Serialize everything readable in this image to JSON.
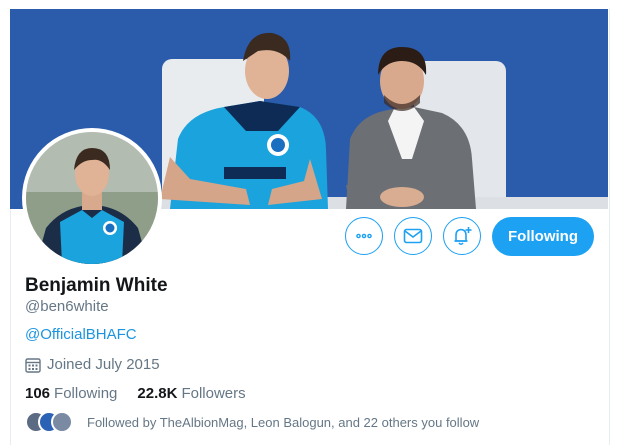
{
  "profile": {
    "name": "Benjamin White",
    "handle": "@ben6white",
    "link": "@OfficialBHAFC",
    "joined": "Joined July 2015"
  },
  "stats": {
    "following_count": "106",
    "following_label": "Following",
    "followers_count": "22.8K",
    "followers_label": "Followers"
  },
  "followed_by": {
    "text": "Followed by TheAlbionMag, Leon Balogun, and 22 others you follow"
  },
  "actions": {
    "more_icon": "more-icon",
    "message_icon": "envelope-icon",
    "notify_icon": "bell-plus-icon",
    "follow_label": "Following"
  },
  "colors": {
    "accent": "#1da1f2",
    "link": "#1b95e0",
    "secondary_text": "#657786",
    "banner_blue": "#2d5eae"
  }
}
